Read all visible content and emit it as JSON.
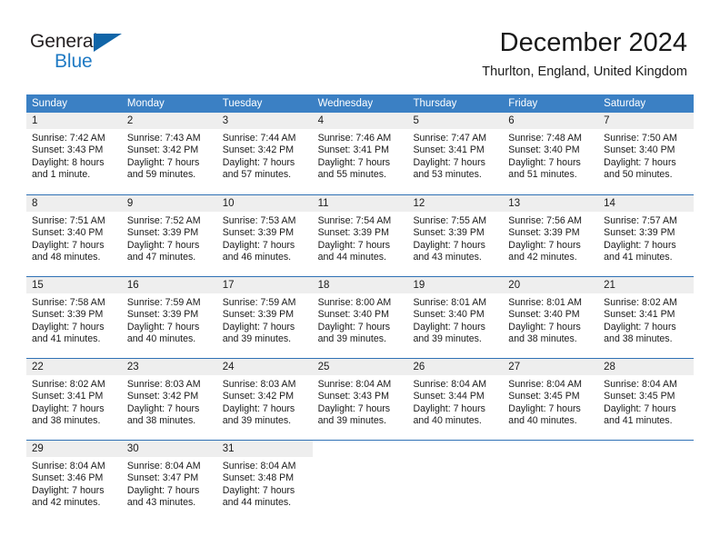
{
  "brand": {
    "name_top": "General",
    "name_bottom": "Blue",
    "triangle_icon": "triangle-icon",
    "color_dark": "#231f20",
    "color_blue": "#1f7ac4",
    "color_triangle": "#1065a8"
  },
  "header": {
    "title": "December 2024",
    "subtitle": "Thurlton, England, United Kingdom"
  },
  "theme": {
    "header_row_bg": "#3b80c4",
    "week_border": "#2f71b5",
    "day_number_bg": "#eeeeee",
    "text": "#1a1a1a"
  },
  "weekdays": [
    "Sunday",
    "Monday",
    "Tuesday",
    "Wednesday",
    "Thursday",
    "Friday",
    "Saturday"
  ],
  "weeks": [
    [
      {
        "day": "1",
        "sunrise": "Sunrise: 7:42 AM",
        "sunset": "Sunset: 3:43 PM",
        "daylight1": "Daylight: 8 hours",
        "daylight2": "and 1 minute."
      },
      {
        "day": "2",
        "sunrise": "Sunrise: 7:43 AM",
        "sunset": "Sunset: 3:42 PM",
        "daylight1": "Daylight: 7 hours",
        "daylight2": "and 59 minutes."
      },
      {
        "day": "3",
        "sunrise": "Sunrise: 7:44 AM",
        "sunset": "Sunset: 3:42 PM",
        "daylight1": "Daylight: 7 hours",
        "daylight2": "and 57 minutes."
      },
      {
        "day": "4",
        "sunrise": "Sunrise: 7:46 AM",
        "sunset": "Sunset: 3:41 PM",
        "daylight1": "Daylight: 7 hours",
        "daylight2": "and 55 minutes."
      },
      {
        "day": "5",
        "sunrise": "Sunrise: 7:47 AM",
        "sunset": "Sunset: 3:41 PM",
        "daylight1": "Daylight: 7 hours",
        "daylight2": "and 53 minutes."
      },
      {
        "day": "6",
        "sunrise": "Sunrise: 7:48 AM",
        "sunset": "Sunset: 3:40 PM",
        "daylight1": "Daylight: 7 hours",
        "daylight2": "and 51 minutes."
      },
      {
        "day": "7",
        "sunrise": "Sunrise: 7:50 AM",
        "sunset": "Sunset: 3:40 PM",
        "daylight1": "Daylight: 7 hours",
        "daylight2": "and 50 minutes."
      }
    ],
    [
      {
        "day": "8",
        "sunrise": "Sunrise: 7:51 AM",
        "sunset": "Sunset: 3:40 PM",
        "daylight1": "Daylight: 7 hours",
        "daylight2": "and 48 minutes."
      },
      {
        "day": "9",
        "sunrise": "Sunrise: 7:52 AM",
        "sunset": "Sunset: 3:39 PM",
        "daylight1": "Daylight: 7 hours",
        "daylight2": "and 47 minutes."
      },
      {
        "day": "10",
        "sunrise": "Sunrise: 7:53 AM",
        "sunset": "Sunset: 3:39 PM",
        "daylight1": "Daylight: 7 hours",
        "daylight2": "and 46 minutes."
      },
      {
        "day": "11",
        "sunrise": "Sunrise: 7:54 AM",
        "sunset": "Sunset: 3:39 PM",
        "daylight1": "Daylight: 7 hours",
        "daylight2": "and 44 minutes."
      },
      {
        "day": "12",
        "sunrise": "Sunrise: 7:55 AM",
        "sunset": "Sunset: 3:39 PM",
        "daylight1": "Daylight: 7 hours",
        "daylight2": "and 43 minutes."
      },
      {
        "day": "13",
        "sunrise": "Sunrise: 7:56 AM",
        "sunset": "Sunset: 3:39 PM",
        "daylight1": "Daylight: 7 hours",
        "daylight2": "and 42 minutes."
      },
      {
        "day": "14",
        "sunrise": "Sunrise: 7:57 AM",
        "sunset": "Sunset: 3:39 PM",
        "daylight1": "Daylight: 7 hours",
        "daylight2": "and 41 minutes."
      }
    ],
    [
      {
        "day": "15",
        "sunrise": "Sunrise: 7:58 AM",
        "sunset": "Sunset: 3:39 PM",
        "daylight1": "Daylight: 7 hours",
        "daylight2": "and 41 minutes."
      },
      {
        "day": "16",
        "sunrise": "Sunrise: 7:59 AM",
        "sunset": "Sunset: 3:39 PM",
        "daylight1": "Daylight: 7 hours",
        "daylight2": "and 40 minutes."
      },
      {
        "day": "17",
        "sunrise": "Sunrise: 7:59 AM",
        "sunset": "Sunset: 3:39 PM",
        "daylight1": "Daylight: 7 hours",
        "daylight2": "and 39 minutes."
      },
      {
        "day": "18",
        "sunrise": "Sunrise: 8:00 AM",
        "sunset": "Sunset: 3:40 PM",
        "daylight1": "Daylight: 7 hours",
        "daylight2": "and 39 minutes."
      },
      {
        "day": "19",
        "sunrise": "Sunrise: 8:01 AM",
        "sunset": "Sunset: 3:40 PM",
        "daylight1": "Daylight: 7 hours",
        "daylight2": "and 39 minutes."
      },
      {
        "day": "20",
        "sunrise": "Sunrise: 8:01 AM",
        "sunset": "Sunset: 3:40 PM",
        "daylight1": "Daylight: 7 hours",
        "daylight2": "and 38 minutes."
      },
      {
        "day": "21",
        "sunrise": "Sunrise: 8:02 AM",
        "sunset": "Sunset: 3:41 PM",
        "daylight1": "Daylight: 7 hours",
        "daylight2": "and 38 minutes."
      }
    ],
    [
      {
        "day": "22",
        "sunrise": "Sunrise: 8:02 AM",
        "sunset": "Sunset: 3:41 PM",
        "daylight1": "Daylight: 7 hours",
        "daylight2": "and 38 minutes."
      },
      {
        "day": "23",
        "sunrise": "Sunrise: 8:03 AM",
        "sunset": "Sunset: 3:42 PM",
        "daylight1": "Daylight: 7 hours",
        "daylight2": "and 38 minutes."
      },
      {
        "day": "24",
        "sunrise": "Sunrise: 8:03 AM",
        "sunset": "Sunset: 3:42 PM",
        "daylight1": "Daylight: 7 hours",
        "daylight2": "and 39 minutes."
      },
      {
        "day": "25",
        "sunrise": "Sunrise: 8:04 AM",
        "sunset": "Sunset: 3:43 PM",
        "daylight1": "Daylight: 7 hours",
        "daylight2": "and 39 minutes."
      },
      {
        "day": "26",
        "sunrise": "Sunrise: 8:04 AM",
        "sunset": "Sunset: 3:44 PM",
        "daylight1": "Daylight: 7 hours",
        "daylight2": "and 40 minutes."
      },
      {
        "day": "27",
        "sunrise": "Sunrise: 8:04 AM",
        "sunset": "Sunset: 3:45 PM",
        "daylight1": "Daylight: 7 hours",
        "daylight2": "and 40 minutes."
      },
      {
        "day": "28",
        "sunrise": "Sunrise: 8:04 AM",
        "sunset": "Sunset: 3:45 PM",
        "daylight1": "Daylight: 7 hours",
        "daylight2": "and 41 minutes."
      }
    ],
    [
      {
        "day": "29",
        "sunrise": "Sunrise: 8:04 AM",
        "sunset": "Sunset: 3:46 PM",
        "daylight1": "Daylight: 7 hours",
        "daylight2": "and 42 minutes."
      },
      {
        "day": "30",
        "sunrise": "Sunrise: 8:04 AM",
        "sunset": "Sunset: 3:47 PM",
        "daylight1": "Daylight: 7 hours",
        "daylight2": "and 43 minutes."
      },
      {
        "day": "31",
        "sunrise": "Sunrise: 8:04 AM",
        "sunset": "Sunset: 3:48 PM",
        "daylight1": "Daylight: 7 hours",
        "daylight2": "and 44 minutes."
      },
      {
        "day": "",
        "sunrise": "",
        "sunset": "",
        "daylight1": "",
        "daylight2": ""
      },
      {
        "day": "",
        "sunrise": "",
        "sunset": "",
        "daylight1": "",
        "daylight2": ""
      },
      {
        "day": "",
        "sunrise": "",
        "sunset": "",
        "daylight1": "",
        "daylight2": ""
      },
      {
        "day": "",
        "sunrise": "",
        "sunset": "",
        "daylight1": "",
        "daylight2": ""
      }
    ]
  ]
}
